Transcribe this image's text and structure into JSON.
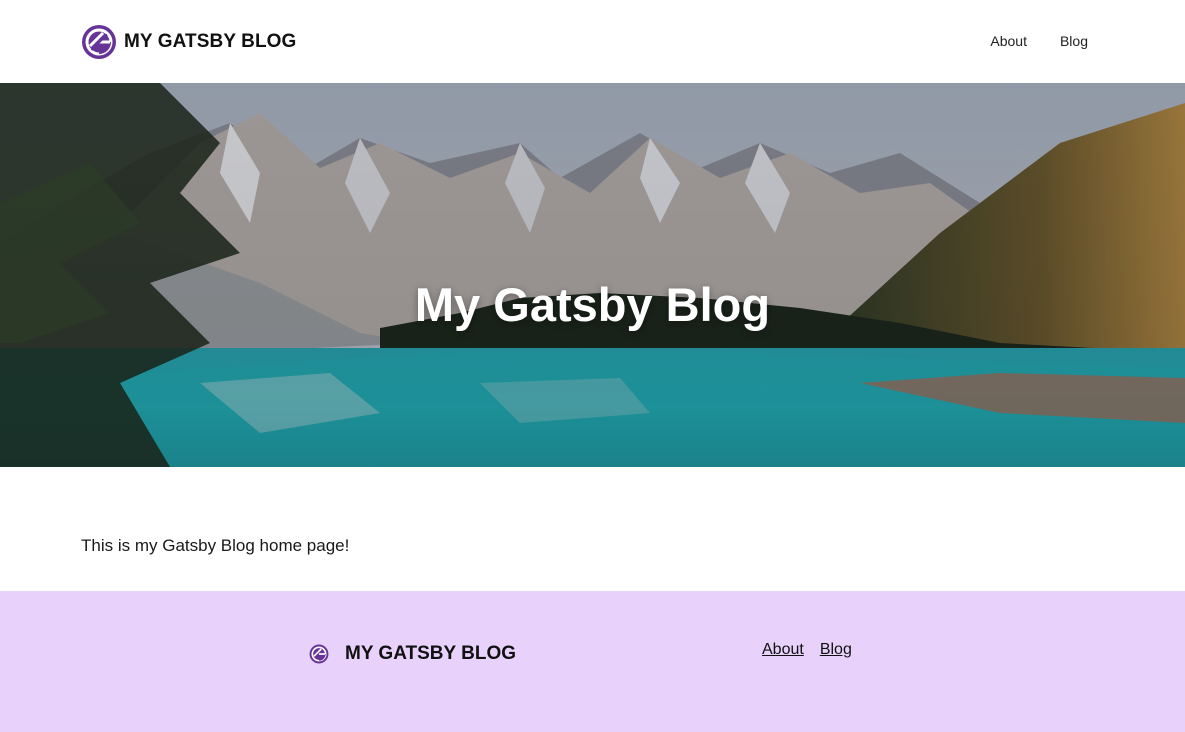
{
  "header": {
    "brand": "MY GATSBY BLOG",
    "logo_icon": "gatsby-logo-icon",
    "nav": [
      {
        "label": "About"
      },
      {
        "label": "Blog"
      }
    ]
  },
  "hero": {
    "title": "My Gatsby Blog",
    "image": "mountain-lake-photo"
  },
  "main": {
    "intro": "This is my Gatsby Blog home page!"
  },
  "footer": {
    "brand": "MY GATSBY BLOG",
    "logo_icon": "gatsby-logo-icon",
    "nav": [
      {
        "label": "About"
      },
      {
        "label": "Blog"
      }
    ]
  },
  "colors": {
    "brand_purple": "#663399",
    "footer_bg": "#e8d2fb",
    "lake_turquoise": "#2fb7c0"
  }
}
